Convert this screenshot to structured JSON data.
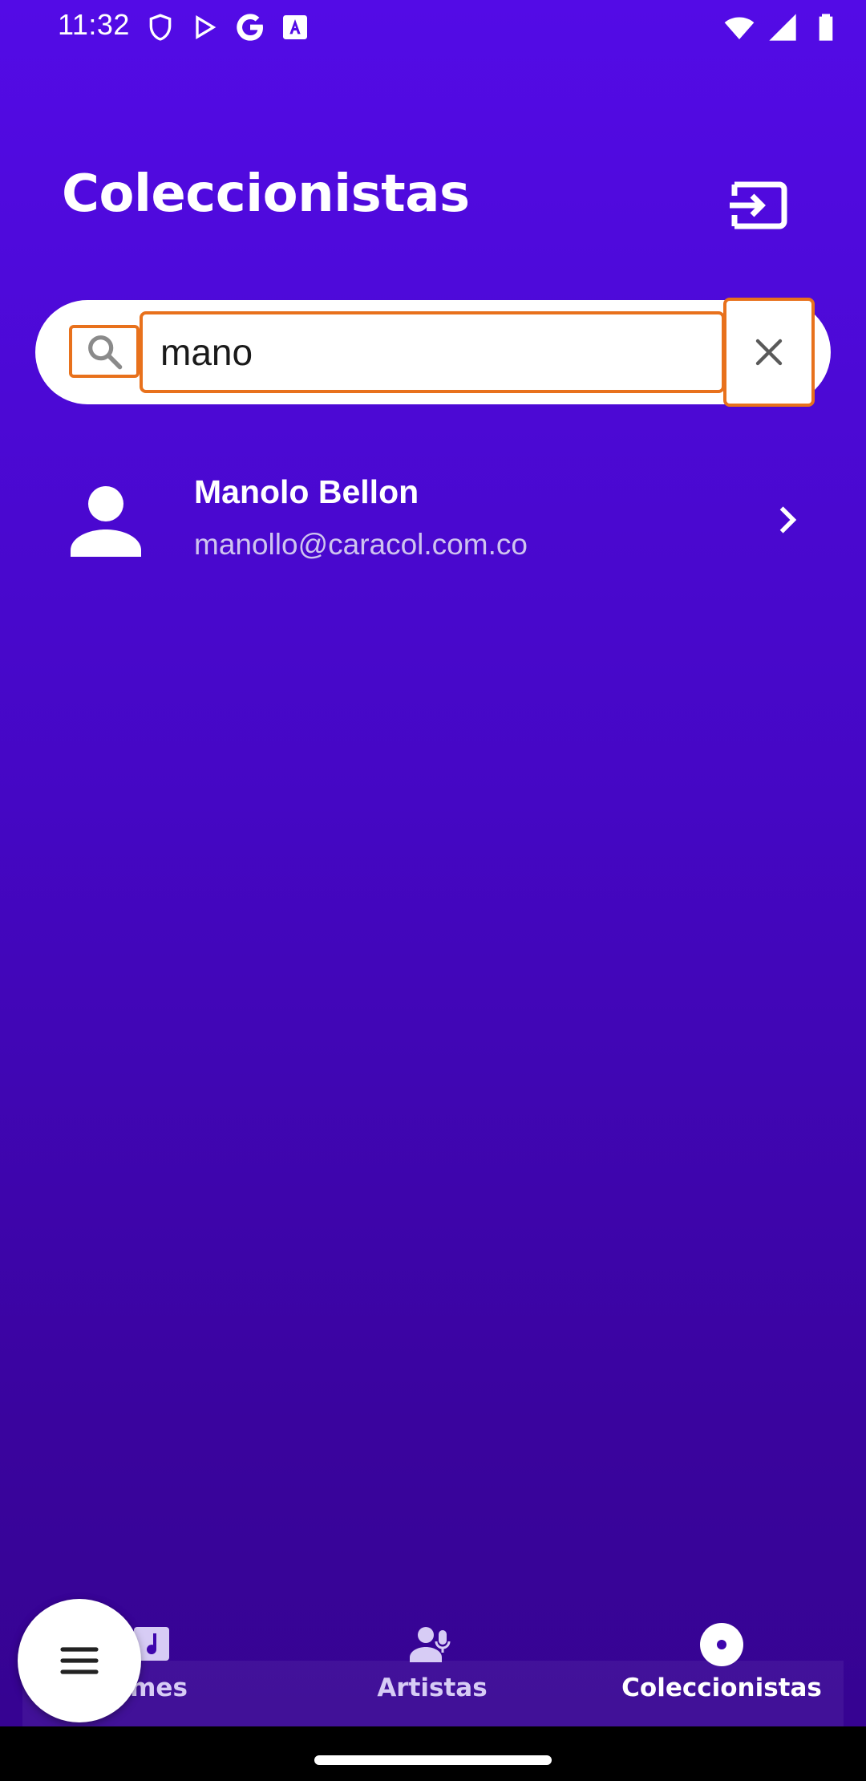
{
  "status_bar": {
    "time": "11:32",
    "icons_left": [
      "shield-icon",
      "play-store-icon",
      "google-icon",
      "font-icon"
    ],
    "icons_right": [
      "wifi-icon",
      "cell-signal-icon",
      "battery-icon"
    ]
  },
  "header": {
    "title": "Coleccionistas",
    "logout_icon": "logout-icon"
  },
  "search": {
    "value": "mano",
    "placeholder": "",
    "search_icon": "search-icon",
    "clear_icon": "close-icon"
  },
  "results": [
    {
      "name": "Manolo Bellon",
      "email": "manollo@caracol.com.co",
      "icon": "person-icon"
    }
  ],
  "bottom_nav": {
    "items": [
      {
        "label": "Álbumes",
        "visible_label": "umes",
        "icon": "album-icon",
        "active": false
      },
      {
        "label": "Artistas",
        "icon": "artist-icon",
        "active": false
      },
      {
        "label": "Coleccionistas",
        "icon": "collector-icon",
        "active": true
      }
    ]
  },
  "fab": {
    "icon": "menu-icon"
  },
  "colors": {
    "background_top": "#530be6",
    "background_bottom": "#35038f",
    "highlight": "#e8711c",
    "secondary_text": "#cfc4ef"
  }
}
